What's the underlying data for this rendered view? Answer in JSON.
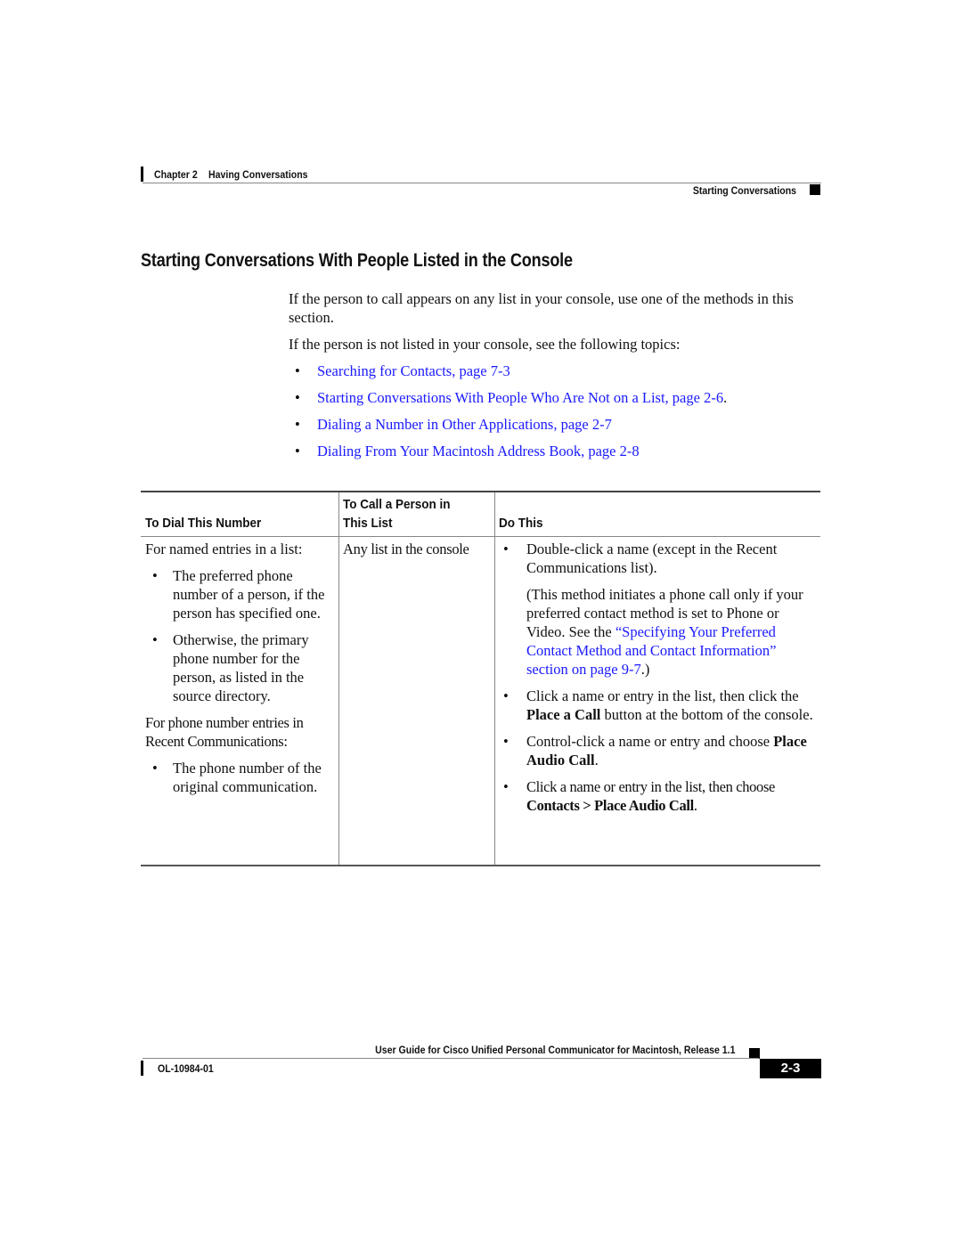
{
  "header": {
    "chapter_label": "Chapter 2",
    "chapter_title": "Having Conversations",
    "section": "Starting Conversations"
  },
  "page_title": "Starting Conversations With People Listed in the Console",
  "intro": {
    "paragraph1": "If the person to call appears on any list in your console, use one of the methods in this section.",
    "paragraph2": "If the person is not listed in your console, see the following topics:"
  },
  "bullet_char": "•",
  "topics": [
    {
      "label": "Searching for Contacts, page 7-3",
      "suffix": ""
    },
    {
      "label": "Starting Conversations With People Who Are Not on a List, page 2-6",
      "suffix": "."
    },
    {
      "label": "Dialing a Number in Other Applications, page 2-7",
      "suffix": ""
    },
    {
      "label": "Dialing From Your Macintosh Address Book, page 2-8",
      "suffix": ""
    }
  ],
  "table": {
    "headers": {
      "col1": "To Dial This Number",
      "col2_line1": "To Call a Person in",
      "col2_line2": "This List",
      "col3": "Do This"
    },
    "col1": {
      "named_intro": "For named entries in a list:",
      "named_items": [
        "The preferred phone number of a person, if the person has specified one.",
        "Otherwise, the primary phone number for the person, as listed in the source directory."
      ],
      "phone_intro": "For phone number entries in Recent Communications:",
      "phone_items": [
        "The phone number of the original communication."
      ]
    },
    "col2": "Any list in the console",
    "col3": {
      "item1": "Double-click a name (except in the Recent Communications list).",
      "item1_note_pre": "(This method initiates a phone call only if your preferred contact method is set to Phone or Video. See the ",
      "item1_note_link": "“Specifying Your Preferred Contact Method and Contact Information” section on page 9-7",
      "item1_note_post": ".)",
      "item2_pre": "Click a name or entry in the list, then click the ",
      "item2_bold": "Place a Call",
      "item2_post": " button at the bottom of the console.",
      "item3_pre": "Control-click a name or entry and choose ",
      "item3_bold": "Place Audio Call",
      "item3_post": ".",
      "item4_pre": "Click a name or entry in the list, then choose ",
      "item4_bold": "Contacts > Place Audio Call",
      "item4_post": "."
    }
  },
  "footer": {
    "guide_title": "User Guide for Cisco Unified Personal Communicator for Macintosh, Release 1.1",
    "doc_number": "OL-10984-01",
    "page_number": "2-3"
  },
  "colors": {
    "link": "#1a1aff",
    "text": "#111111",
    "rule": "#888888"
  }
}
